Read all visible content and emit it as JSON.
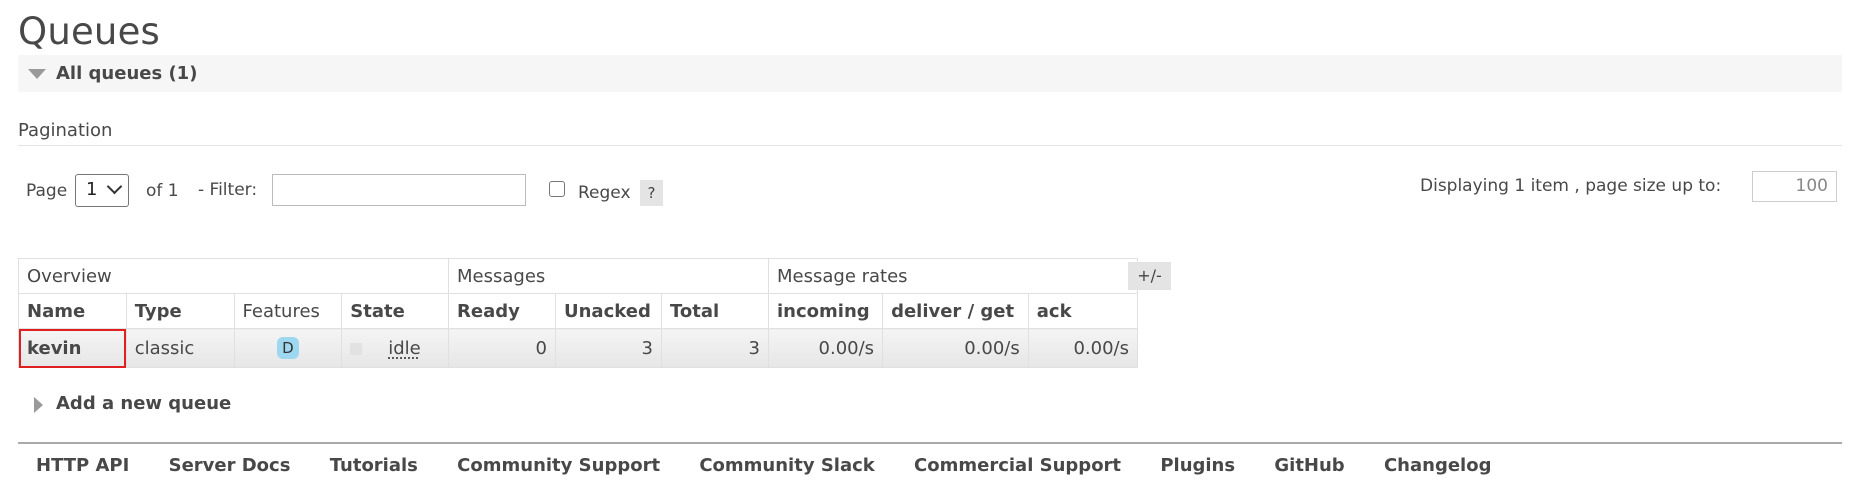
{
  "page": {
    "title": "Queues"
  },
  "section": {
    "label": "All queues (1)"
  },
  "pagination": {
    "heading": "Pagination",
    "page_label": "Page",
    "page_value": "1",
    "of_label": "of 1",
    "filter_label": "- Filter:",
    "filter_value": "",
    "regex_label": "Regex",
    "help_label": "?",
    "display_label": "Displaying 1 item , page size up to:",
    "page_size": "100"
  },
  "table": {
    "groups": [
      "Overview",
      "Messages",
      "Message rates"
    ],
    "columns": [
      "Name",
      "Type",
      "Features",
      "State",
      "Ready",
      "Unacked",
      "Total",
      "incoming",
      "deliver / get",
      "ack"
    ],
    "rows": [
      {
        "name": "kevin",
        "type": "classic",
        "feature": "D",
        "state": "idle",
        "ready": "0",
        "unacked": "3",
        "total": "3",
        "incoming": "0.00/s",
        "deliver_get": "0.00/s",
        "ack": "0.00/s"
      }
    ],
    "toggle_label": "+/-"
  },
  "add_queue": {
    "label": "Add a new queue"
  },
  "footer": {
    "links": [
      "HTTP API",
      "Server Docs",
      "Tutorials",
      "Community Support",
      "Community Slack",
      "Commercial Support",
      "Plugins",
      "GitHub",
      "Changelog"
    ]
  }
}
